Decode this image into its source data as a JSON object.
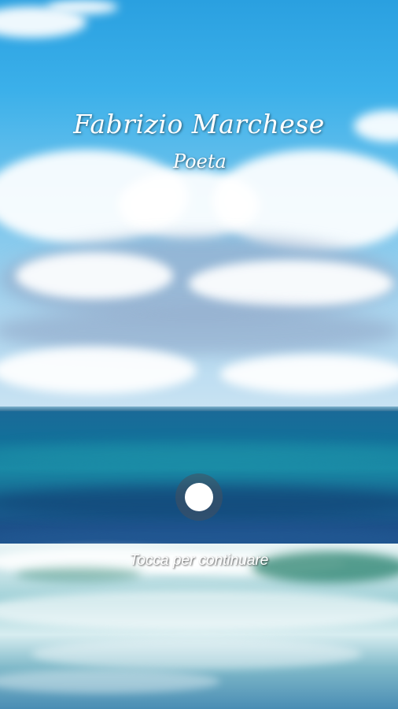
{
  "splash": {
    "title": "Fabrizio Marchese",
    "subtitle": "Poeta",
    "hint": "Tocca per continuare"
  },
  "icons": {
    "tap": "circle-dot-icon"
  },
  "colors": {
    "text": "#ffffff",
    "sky": "#3bb0ea",
    "sea": "#1a6a98",
    "tap_ring": "#46505f"
  }
}
